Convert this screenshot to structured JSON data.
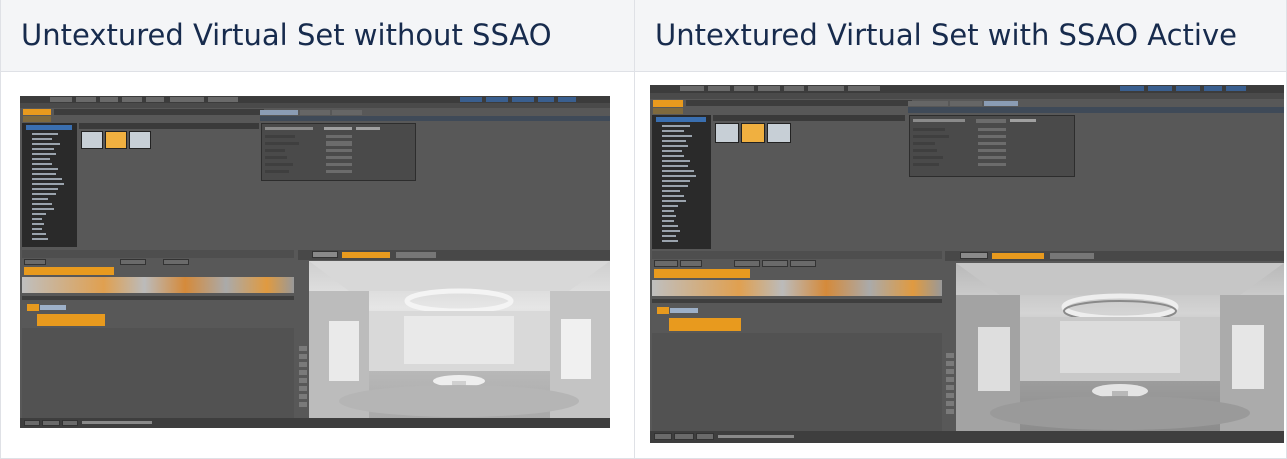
{
  "table": {
    "columns": [
      {
        "header": "Untextured Virtual Set without SSAO",
        "image_label": "viz-artist-untextured-set-ssao-off"
      },
      {
        "header": "Untextured Virtual Set with SSAO Active",
        "image_label": "viz-artist-untextured-set-ssao-on"
      }
    ]
  }
}
